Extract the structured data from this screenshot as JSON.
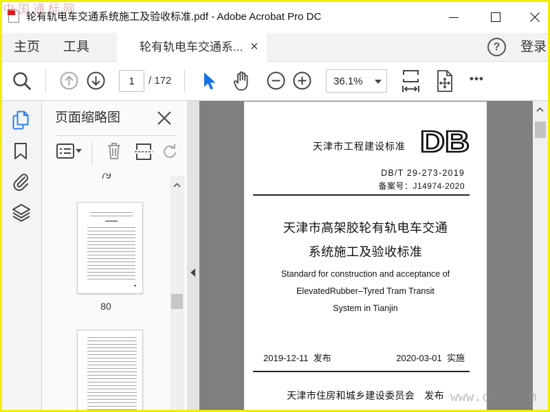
{
  "window": {
    "title": "轮有轨电车交通系统施工及验收标准.pdf - Adobe Acrobat Pro DC"
  },
  "watermarks": {
    "top_left": "中国通标网",
    "bottom_right_start": "www.cn",
    "bottom_right_end": "m"
  },
  "menu": {
    "home": "主页",
    "tools": "工具",
    "document_tab": "轮有轨电车交通系...",
    "tab_close": "×",
    "help": "?",
    "sign_in": "登录"
  },
  "toolbar": {
    "current_page": "1",
    "page_total": "/ 172",
    "zoom": "36.1%",
    "more": "•••"
  },
  "thumbnails_panel": {
    "title": "页面缩略图",
    "pages": [
      {
        "label": "79"
      },
      {
        "label": "80"
      }
    ]
  },
  "document": {
    "issuer_header": "天津市工程建设标准",
    "logo": "DB",
    "standard_number": "DB/T 29-273-2019",
    "record_number": "备案号：J14974-2020",
    "title_zh_line1": "天津市高架胶轮有轨电车交通",
    "title_zh_line2": "系统施工及验收标准",
    "title_en_line1": "Standard for construction and acceptance of",
    "title_en_line2": "ElevatedRubber–Tyred Tram Transit",
    "title_en_line3": "System in Tianjin",
    "release_date": "2019-12-11  发布",
    "implement_date": "2020-03-01  实施",
    "publisher": "天津市住房和城乡建设委员会　发布"
  },
  "icons": {
    "window": [
      "pdf-file-icon",
      "minimize-icon",
      "maximize-icon",
      "close-icon"
    ],
    "toolbar": [
      "search-icon",
      "previous-page-icon",
      "next-page-icon",
      "select-cursor-icon",
      "hand-tool-icon",
      "zoom-out-icon",
      "zoom-in-icon",
      "chevron-down-icon",
      "fit-page-icon",
      "page-move-icon"
    ],
    "rail": [
      "page-thumbnails-icon",
      "bookmark-icon",
      "paperclip-icon",
      "layers-icon"
    ],
    "panel": [
      "close-icon",
      "thumbnail-options-icon",
      "trash-icon",
      "split-page-icon",
      "rotate-icon",
      "chevron-up-icon",
      "collapse-left-icon"
    ]
  },
  "colors": {
    "accent": "#1473e6",
    "active_rail_icon": "#2680eb",
    "document_background": "#808080",
    "window_frame": "#f2ee00"
  }
}
